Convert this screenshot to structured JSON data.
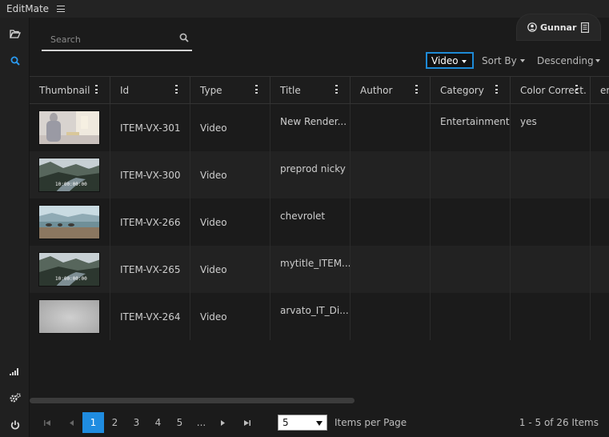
{
  "app": {
    "title": "EditMate"
  },
  "search": {
    "placeholder": "Search"
  },
  "user": {
    "name": "Gunnar"
  },
  "filters": {
    "type_value": "Video",
    "sort_by_label": "Sort By",
    "order_label": "Descending"
  },
  "columns": [
    "Thumbnail",
    "Id",
    "Type",
    "Title",
    "Author",
    "Category",
    "Color Correct.",
    "en"
  ],
  "rows": [
    {
      "id": "ITEM-VX-301",
      "type": "Video",
      "title": "New Render...",
      "author": "",
      "category": "Entertainment",
      "color_correct": "yes",
      "thumb": "indoor-person",
      "timecode": ""
    },
    {
      "id": "ITEM-VX-300",
      "type": "Video",
      "title": "preprod nicky",
      "author": "",
      "category": "",
      "color_correct": "",
      "thumb": "fjord",
      "timecode": "10:00:00:00"
    },
    {
      "id": "ITEM-VX-266",
      "type": "Video",
      "title": "chevrolet",
      "author": "",
      "category": "",
      "color_correct": "",
      "thumb": "beach",
      "timecode": ""
    },
    {
      "id": "ITEM-VX-265",
      "type": "Video",
      "title": "mytitle_ITEM...",
      "author": "",
      "category": "",
      "color_correct": "",
      "thumb": "fjord",
      "timecode": "10:00:00:00"
    },
    {
      "id": "ITEM-VX-264",
      "type": "Video",
      "title": "arvato_IT_Di...",
      "author": "",
      "category": "",
      "color_correct": "",
      "thumb": "blurred",
      "timecode": ""
    }
  ],
  "pagination": {
    "pages": [
      "1",
      "2",
      "3",
      "4",
      "5",
      "..."
    ],
    "current_page": "1",
    "per_page": "5",
    "per_page_label": "Items per Page",
    "range_text": "1 - 5 of 26 Items"
  },
  "icons": {
    "rail_top": [
      "folder-open-icon",
      "search-icon"
    ],
    "rail_bottom": [
      "signal-bars-icon",
      "gears-icon",
      "power-icon"
    ],
    "pager": [
      "first-page-icon",
      "prev-page-icon",
      "next-page-icon",
      "last-page-icon"
    ]
  },
  "colors": {
    "accent": "#1f8ce0",
    "background": "#1b1b1b"
  }
}
